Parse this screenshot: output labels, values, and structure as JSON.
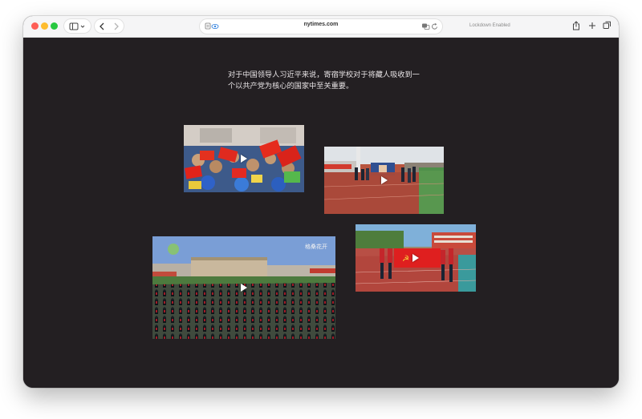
{
  "browser": {
    "address": "nytimes.com",
    "status_text": "Lockdown Enabled"
  },
  "article": {
    "paragraph": "对于中国领导人习近平来说，寄宿学校对于将藏人吸收到一个以共产党为核心的国家中至关重要。"
  },
  "videos": [
    {
      "id": "video-1",
      "subject": "children waving flags"
    },
    {
      "id": "video-2",
      "subject": "ceremony on running track"
    },
    {
      "id": "video-3",
      "subject": "students exercising in square",
      "watermark": "格桑花开"
    },
    {
      "id": "video-4",
      "subject": "flag procession"
    }
  ],
  "colors": {
    "page_background": "#231f22",
    "toolbar_background": "#f5f5f6",
    "text": "#e8e4e6"
  }
}
